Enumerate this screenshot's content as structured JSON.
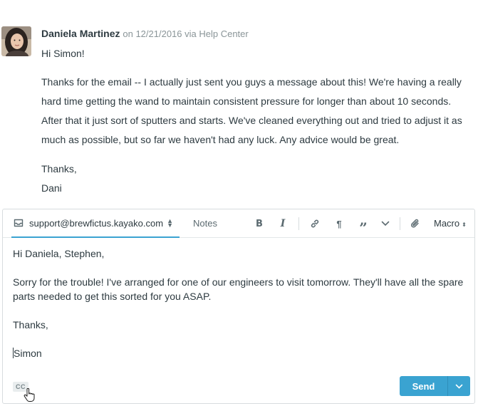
{
  "message": {
    "author": "Daniela Martinez",
    "meta": "on 12/21/2016 via Help Center",
    "greeting": "Hi Simon!",
    "body": "Thanks for the email -- I actually just sent you guys a message about this! We're having a really hard time getting the wand to maintain consistent pressure for longer than about 10 seconds. After that it just sort of sputters and starts. We've cleaned everything out and tried to adjust it as much as possible, but so far we haven't had any luck. Any advice would be great.",
    "signoff": "Thanks,",
    "signature": "Dani"
  },
  "composer": {
    "from_address": "support@brewfictus.kayako.com",
    "notes_tab": "Notes",
    "macro_label": "Macro",
    "toolbar_icons": [
      "bold-icon",
      "italic-icon",
      "link-icon",
      "paragraph-icon",
      "quote-icon",
      "chevron-down-icon",
      "attachment-icon"
    ],
    "bold_glyph": "B",
    "italic_glyph": "I",
    "paragraph_glyph": "¶",
    "quote_glyph": "”",
    "editor": {
      "line1": "Hi Daniela, Stephen,",
      "line2": "Sorry for the trouble! I've arranged for one of our engineers to visit tomorrow. They'll have all the spare parts needed to get this sorted for you ASAP.",
      "line3": "Thanks,",
      "line4": "Simon"
    },
    "cc_label": "CC",
    "send_label": "Send"
  },
  "colors": {
    "accent": "#3aa3d1",
    "text": "#2d3a40",
    "muted": "#8a9598",
    "border": "#d7dcde"
  }
}
